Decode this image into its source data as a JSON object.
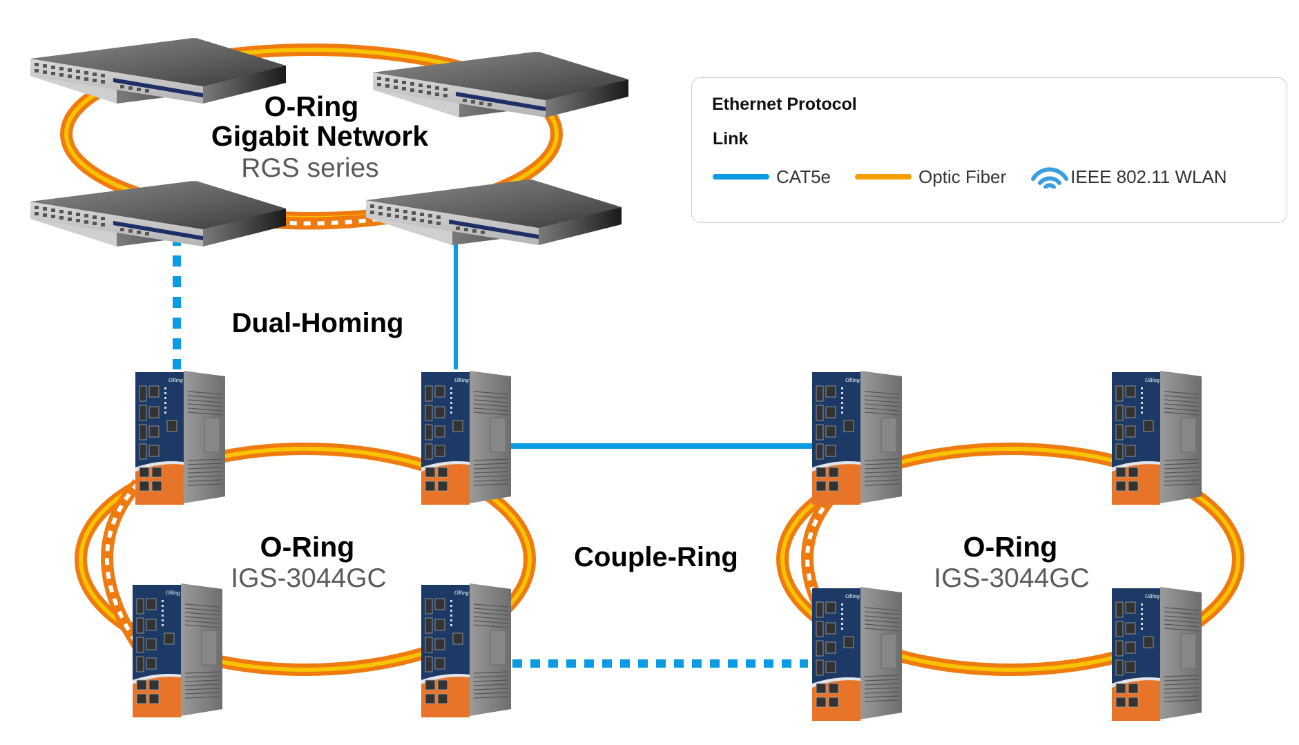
{
  "colors": {
    "cat5e": "#0b9be3",
    "fiber_outer": "#ef7a10",
    "fiber_inner": "#f8c300",
    "legend_fiber": "#f5a000",
    "wlan": "#3a9fe0",
    "legend_border": "#c8c8c8",
    "device_front": "#1d3a66",
    "device_accent": "#e8742a"
  },
  "top_ring": {
    "title": "O-Ring",
    "subtitle": "Gigabit Network",
    "series": "RGS series",
    "devices": [
      {
        "name": "rgs-switch-top-left"
      },
      {
        "name": "rgs-switch-top-right"
      },
      {
        "name": "rgs-switch-bottom-left"
      },
      {
        "name": "rgs-switch-bottom-right"
      }
    ]
  },
  "labels": {
    "dual_homing": "Dual-Homing",
    "couple_ring": "Couple-Ring"
  },
  "left_ring": {
    "title": "O-Ring",
    "model": "IGS-3044GC",
    "devices": [
      {
        "name": "igs-switch-top-left"
      },
      {
        "name": "igs-switch-top-right"
      },
      {
        "name": "igs-switch-bottom-left"
      },
      {
        "name": "igs-switch-bottom-right"
      }
    ]
  },
  "right_ring": {
    "title": "O-Ring",
    "model": "IGS-3044GC",
    "devices": [
      {
        "name": "igs-switch-top-left"
      },
      {
        "name": "igs-switch-top-right"
      },
      {
        "name": "igs-switch-bottom-left"
      },
      {
        "name": "igs-switch-bottom-right"
      }
    ]
  },
  "device_brand": "ORing",
  "legend": {
    "title": "Ethernet Protocol",
    "subtitle": "Link",
    "items": [
      {
        "label": "CAT5e",
        "icon": "line-swatch"
      },
      {
        "label": "Optic Fiber",
        "icon": "line-swatch"
      },
      {
        "label": "IEEE 802.11 WLAN",
        "icon": "wifi-icon"
      }
    ]
  }
}
